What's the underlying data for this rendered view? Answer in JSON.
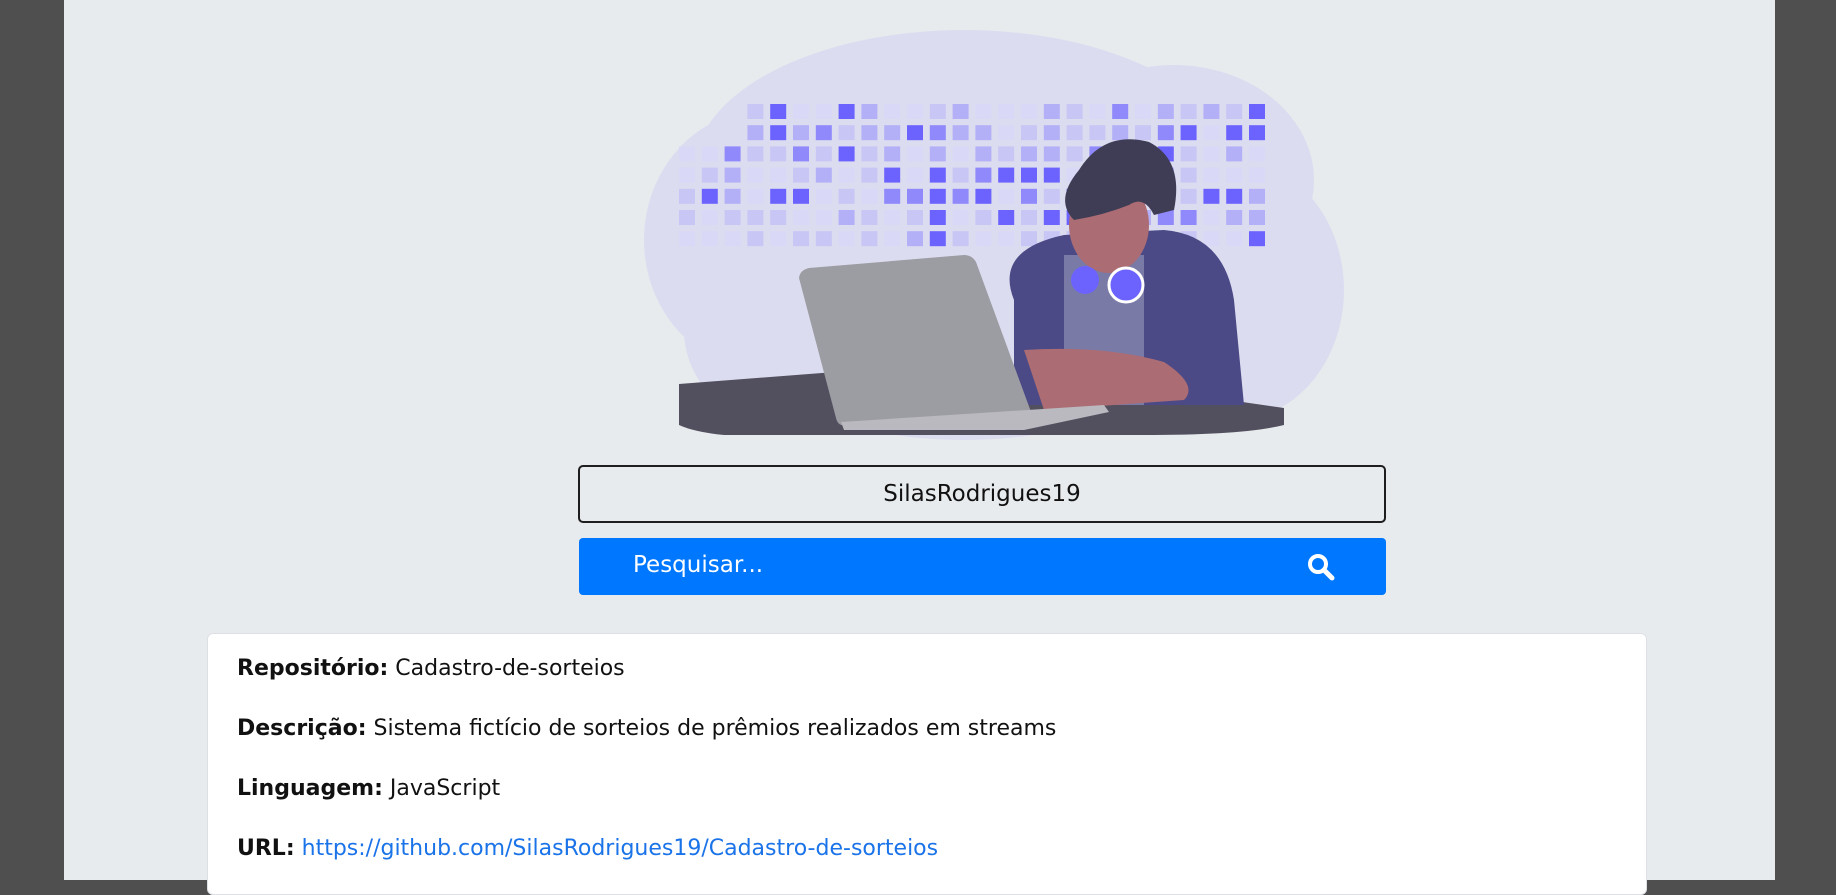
{
  "search": {
    "username_value": "SilasRodrigues19",
    "button_label": "Pesquisar...",
    "button_icon": "search-icon"
  },
  "repo": {
    "name_label": "Repositório:",
    "name_value": "Cadastro-de-sorteios",
    "description_label": "Descrição:",
    "description_value": "Sistema fictício de sorteios de prêmios realizados em streams",
    "language_label": "Linguagem:",
    "language_value": "JavaScript",
    "url_label": "URL:",
    "url_value": "https://github.com/SilasRodrigues19/Cadastro-de-sorteios"
  },
  "colors": {
    "accent": "#0077ff",
    "page_background": "#e8ebee",
    "outer_background": "#4f4f4f",
    "link": "#1a73e8",
    "illustration_purple": "#6c63ff"
  }
}
